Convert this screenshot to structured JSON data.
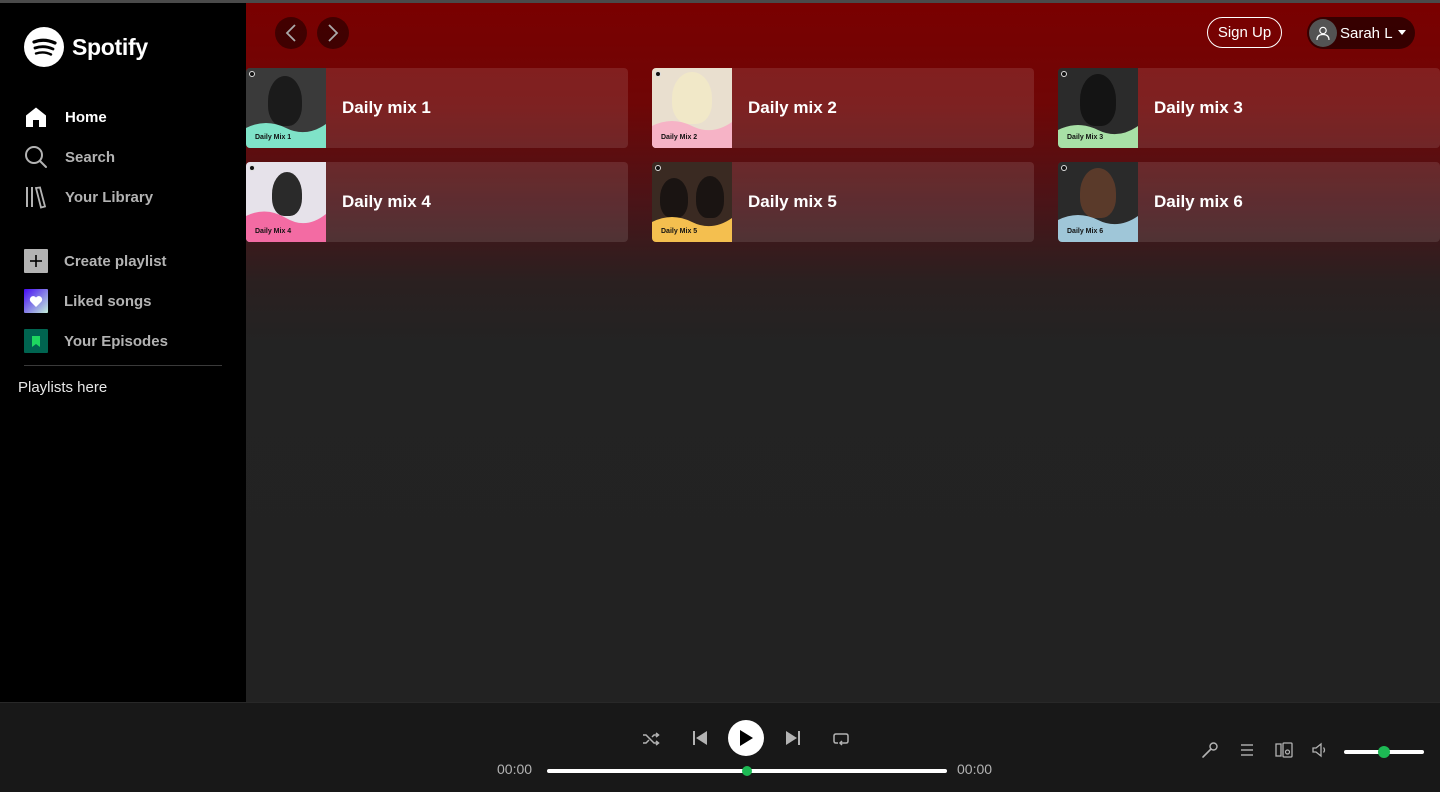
{
  "brand": {
    "name": "Spotify",
    "accent": "#1db954"
  },
  "sidebar": {
    "nav": [
      {
        "label": "Home",
        "icon": "home-icon",
        "active": true
      },
      {
        "label": "Search",
        "icon": "search-icon",
        "active": false
      },
      {
        "label": "Your Library",
        "icon": "library-icon",
        "active": false
      }
    ],
    "actions": [
      {
        "label": "Create playlist",
        "icon": "plus-icon"
      },
      {
        "label": "Liked songs",
        "icon": "heart-icon"
      },
      {
        "label": "Your Episodes",
        "icon": "bookmark-icon"
      }
    ],
    "playlists_label": "Playlists here"
  },
  "header": {
    "signup_label": "Sign Up",
    "user_name": "Sarah L"
  },
  "mixes": [
    {
      "title": "Daily mix 1",
      "cover_label": "Daily Mix 1",
      "color": "#7fe3c8"
    },
    {
      "title": "Daily mix 2",
      "cover_label": "Daily Mix 2",
      "color": "#f6b3c6"
    },
    {
      "title": "Daily mix 3",
      "cover_label": "Daily Mix 3",
      "color": "#a8e0a6"
    },
    {
      "title": "Daily mix 4",
      "cover_label": "Daily Mix 4",
      "color": "#f36ba3"
    },
    {
      "title": "Daily mix 5",
      "cover_label": "Daily Mix 5",
      "color": "#f4bf4f"
    },
    {
      "title": "Daily mix 6",
      "cover_label": "Daily Mix 6",
      "color": "#9fc6d8"
    }
  ],
  "player": {
    "current_time": "00:00",
    "total_time": "00:00",
    "progress": 0.5,
    "volume": 0.5
  }
}
